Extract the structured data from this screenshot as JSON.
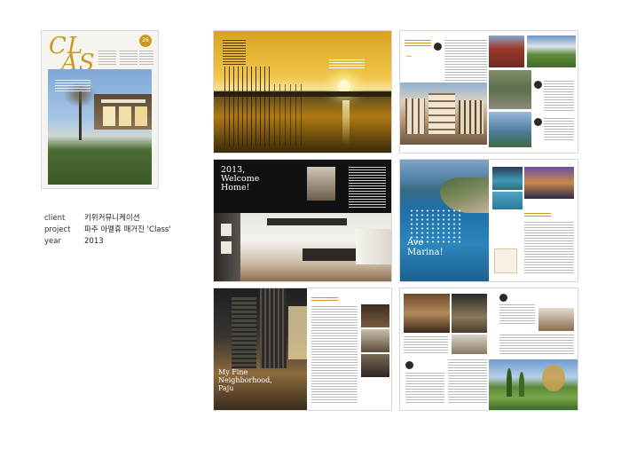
{
  "cover": {
    "logo": "CLASS",
    "letters": [
      "CL",
      "AS",
      "S"
    ],
    "issue": "26"
  },
  "info": {
    "rows": [
      {
        "key": "client",
        "value": "키위커뮤니케이션"
      },
      {
        "key": "project",
        "value": "파주 아멜휴 매거진 'Class'"
      },
      {
        "key": "year",
        "value": "2013"
      }
    ]
  },
  "spreads": {
    "welcome": {
      "headline": "2013,\nWelcome\nHome!"
    },
    "marina": {
      "headline": "Ave\nMarina!"
    },
    "neighborhood": {
      "headline": "My Fine\nNeighborhood,\nPaju"
    }
  },
  "colors": {
    "accent": "#c99a1e",
    "sunset": "#d4a01c",
    "sea": "#1f6fa8"
  }
}
